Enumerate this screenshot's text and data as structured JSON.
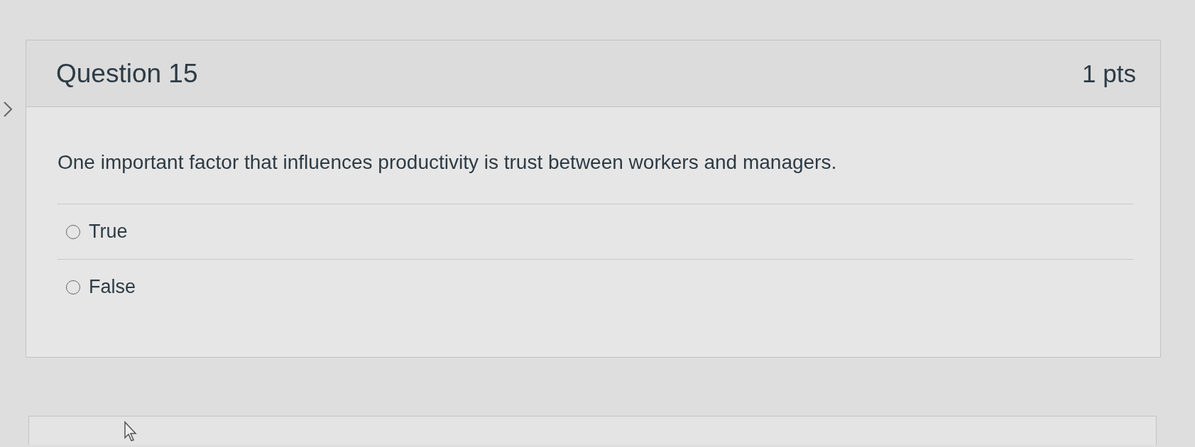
{
  "question": {
    "title": "Question 15",
    "points": "1 pts",
    "text": "One important factor that influences productivity is trust between workers and managers.",
    "answers": [
      {
        "label": "True",
        "selected": false
      },
      {
        "label": "False",
        "selected": false
      }
    ]
  }
}
